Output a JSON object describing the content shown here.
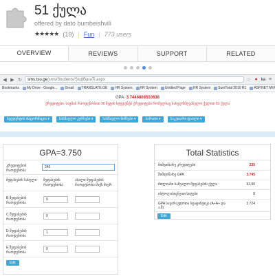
{
  "extension": {
    "title": "51 ქულა",
    "offered_by": "offered by dato bumbeishvili",
    "stars": "★★★★★",
    "rating_count": "(19)",
    "category": "Fun",
    "users": "773 users"
  },
  "tabs": [
    {
      "label": "OVERVIEW",
      "active": true
    },
    {
      "label": "REVIEWS",
      "active": false
    },
    {
      "label": "SUPPORT",
      "active": false
    },
    {
      "label": "RELATED",
      "active": false
    }
  ],
  "carousel": {
    "count": 5,
    "active_index": 3
  },
  "browser": {
    "url_host": "sms.tsu.ge",
    "url_path": "/sms/Students/StudBaraTi.aspx",
    "bookmarks": [
      "Bookmarks",
      "My Drive - Google...",
      "Gmail",
      "TRANSLATE.GE",
      "HR System",
      "HR System",
      "Untitled Page",
      "HR System",
      "SumTotal 2010 R1",
      "ASP.NET MVC Repo..."
    ],
    "ka_label": "ka"
  },
  "page": {
    "gpa_prefix": "GPA:",
    "gpa_value": "3.7446808510638",
    "notice": "ქრედიტები, საგნის რაოდენობით 30 მეტის სტუდენტს ქრედიტები რომელსაც სახელმძღვანელო ქულით 51 ქულა",
    "toolbar": [
      "სტუდენტის ინფორმაცია ▾",
      "სასწავლო კურსები ▾",
      "სასწავლო ნიშნები ▾",
      "ბარათი ▾",
      "საკუთარი ფაილი ▾"
    ]
  },
  "left_panel": {
    "title": "GPA=3.750",
    "gpa_label": "კრედიტების რაოდენობა",
    "gpa_value": "240",
    "col_subject": "შეფასების სახელი",
    "col_count": "შეფასების რაოდენობა",
    "col_new": "ახალი შეფასების რაოდენობა მაქს მიერ",
    "rows": [
      {
        "label": "B შეფასების რაოდენობა",
        "value": "9"
      },
      {
        "label": "C შეფასების რაოდენობა",
        "value": "0"
      },
      {
        "label": "D შეფასების რაოდენობა",
        "value": "1"
      },
      {
        "label": "E შეფასების რაოდენობა",
        "value": "0"
      }
    ],
    "button": "Edit"
  },
  "right_panel": {
    "title": "Total Statistics",
    "rows": [
      {
        "key": "მიმდინარე კრედიტები",
        "value": "235",
        "highlight": true
      },
      {
        "key": "მიმდინარე GPA",
        "value": "3.745",
        "highlight": true
      },
      {
        "key": "მთლიანი საშუალო შეფასების ქულა",
        "value": "93.90",
        "highlight": false
      },
      {
        "key": "ისტოლაბიცნეით სიტები",
        "value": "8",
        "highlight": false
      },
      {
        "key": "GPA სავარაუდოთა სტატისტიკა (A+A+ და ა.შ)",
        "value": "3.724",
        "highlight": false
      }
    ],
    "button": "Edit"
  }
}
